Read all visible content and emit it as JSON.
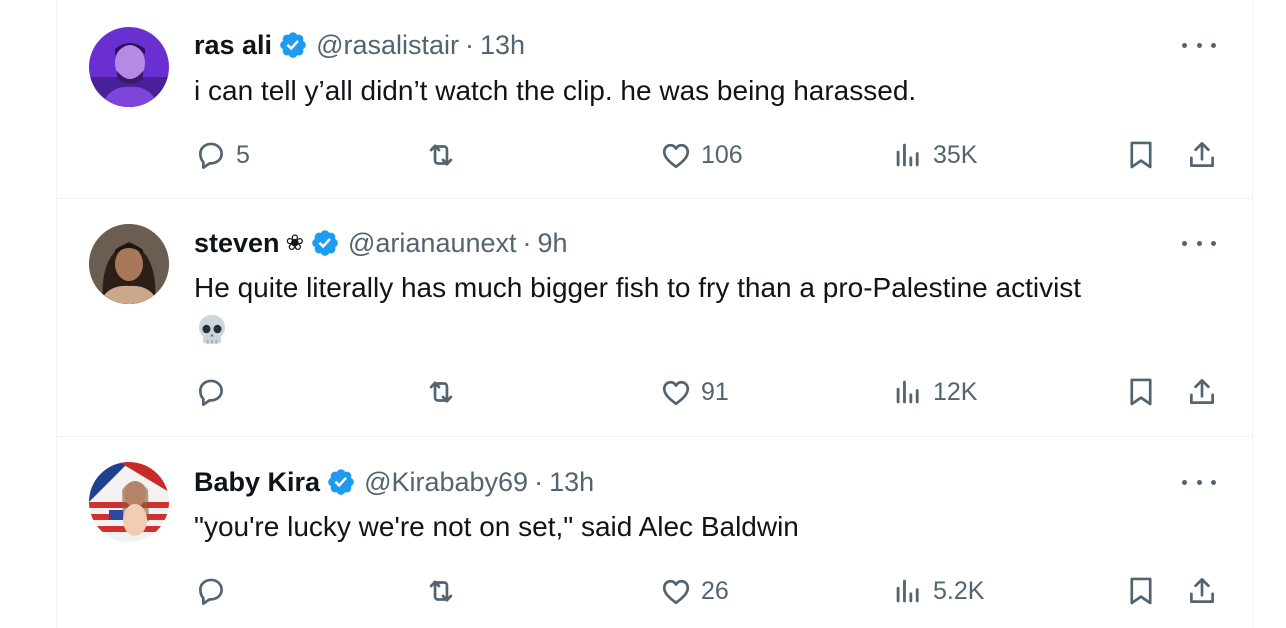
{
  "colors": {
    "text": "#0f1419",
    "secondary": "#536471",
    "verified": "#1d9bf0",
    "divider": "#eff3f4"
  },
  "tweets": [
    {
      "name": "ras ali",
      "name_suffix": "",
      "handle": "@rasalistair",
      "separator": "·",
      "time": "13h",
      "text": "i can tell y’all didn’t watch the clip. he was being harassed.",
      "emoji": "",
      "replies": "5",
      "reposts": "",
      "likes": "106",
      "views": "35K"
    },
    {
      "name": "steven",
      "name_suffix": "❀",
      "handle": "@arianaunext",
      "separator": "·",
      "time": "9h",
      "text": "He quite literally has much bigger fish to fry than a pro-Palestine activist",
      "emoji": "skull-emoji",
      "replies": "",
      "reposts": "",
      "likes": "91",
      "views": "12K"
    },
    {
      "name": "Baby Kira",
      "name_suffix": "",
      "handle": "@Kirababy69",
      "separator": "·",
      "time": "13h",
      "text": "\"you're lucky we're not on set,\" said Alec Baldwin",
      "emoji": "",
      "replies": "",
      "reposts": "",
      "likes": "26",
      "views": "5.2K"
    }
  ]
}
